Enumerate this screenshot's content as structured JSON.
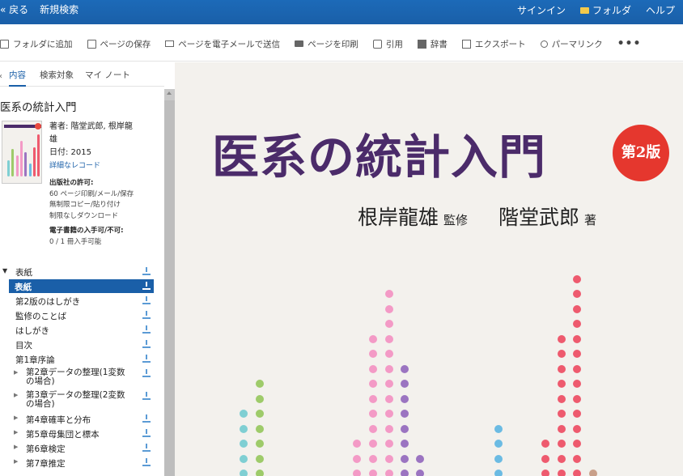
{
  "topbar": {
    "back": "« 戻る",
    "new_search": "新規検索",
    "sign_in": "サインイン",
    "folder": "フォルダ",
    "help": "ヘルプ"
  },
  "toolbar": {
    "add_folder": "フォルダに追加",
    "save_page": "ページの保存",
    "email_page": "ページを電子メールで送信",
    "print_page": "ページを印刷",
    "cite": "引用",
    "dictionary": "辞書",
    "export": "エクスポート",
    "permalink": "パーマリンク",
    "more": "•••"
  },
  "sidebar": {
    "tabs": [
      "内容",
      "検索対象",
      "マイ ノート"
    ],
    "doc_title": "医系の統計入門",
    "author_line": "著者: 階堂武郎, 根岸龍雄",
    "date_line": "日付: 2015",
    "detail_link": "詳細なレコード",
    "publisher_perm_heading": "出版社の許可:",
    "perm_lines": [
      "60 ページ印刷/メール/保存",
      "無制限コピー/貼り付け",
      "制限なしダウンロード"
    ],
    "ebook_heading": "電子書籍の入手可/不可:",
    "ebook_value": "0 / 1 冊入手可能"
  },
  "toc": [
    "表紙",
    "表紙",
    "第2版のはしがき",
    "監修のことば",
    "はしがき",
    "目次",
    "第1章序論",
    "第2章データの整理(1変数の場合)",
    "第3章データの整理(2変数の場合)",
    "第4章確率と分布",
    "第5章母集団と標本",
    "第6章検定",
    "第7章推定"
  ],
  "cover": {
    "title": "医系の統計入門",
    "edition": "第2版",
    "author1": "根岸龍雄",
    "role1": "監修",
    "author2": "階堂武郎",
    "role2": "著"
  },
  "colors": {
    "brand_blue": "#1a5fa8",
    "title_purple": "#4b2b6a",
    "edition_red": "#e5372e",
    "cover_bg": "#f3f1ed"
  }
}
